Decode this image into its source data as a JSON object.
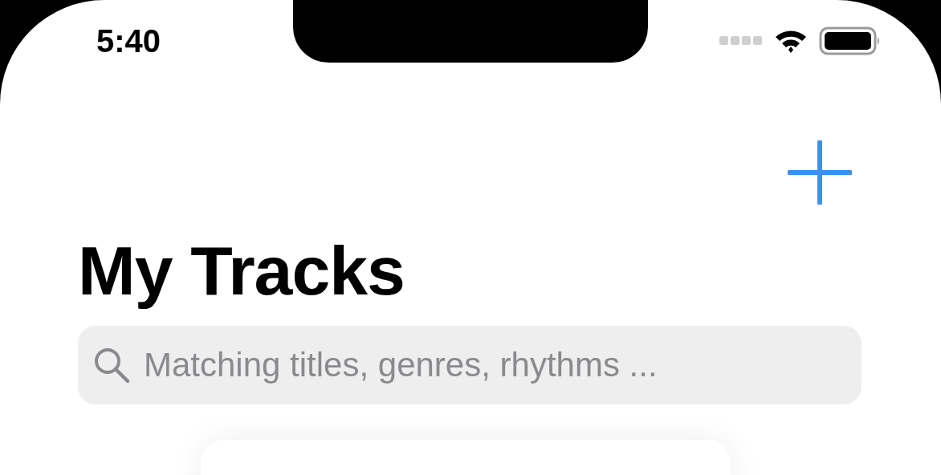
{
  "status_bar": {
    "time": "5:40"
  },
  "header": {
    "title": "My Tracks"
  },
  "search": {
    "placeholder": "Matching titles, genres, rhythms ..."
  }
}
